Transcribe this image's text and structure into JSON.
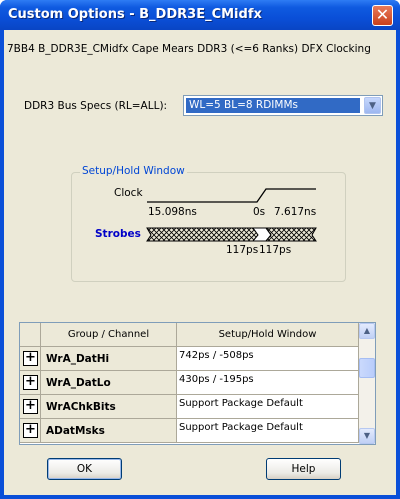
{
  "window": {
    "title": "Custom Options - B_DDR3E_CMidfx",
    "close_glyph": "✕"
  },
  "description": "7BB4 B_DDR3E_CMidfx Cape Mears DDR3 (<=6 Ranks) DFX Clocking",
  "bus_specs": {
    "label": "DDR3 Bus Specs (RL=ALL):",
    "selected": "WL=5  BL=8  RDIMMs",
    "dropdown_icon": "chevron-down-icon"
  },
  "setup_hold": {
    "legend": "Setup/Hold Window",
    "clock_label": "Clock",
    "strobes_label": "Strobes",
    "clock_left": "15.098ns",
    "clock_mid": "0s",
    "clock_right": "7.617ns",
    "strobe_left": "117ps",
    "strobe_right": "117ps"
  },
  "table": {
    "headers": [
      "Group / Channel",
      "Setup/Hold Window"
    ],
    "rows": [
      {
        "expand": "+",
        "channel": "WrA_DatHi",
        "window": "742ps / -508ps"
      },
      {
        "expand": "+",
        "channel": "WrA_DatLo",
        "window": "430ps / -195ps"
      },
      {
        "expand": "+",
        "channel": "WrAChkBits",
        "window": "Support Package Default"
      },
      {
        "expand": "+",
        "channel": "ADatMsks",
        "window": "Support Package Default"
      }
    ]
  },
  "buttons": {
    "ok": "OK",
    "help": "Help"
  },
  "colors": {
    "title_bar": "#0a4fd8",
    "selection": "#316ac5",
    "strobes_text": "#0000c8",
    "group_legend": "#0046d5",
    "dialog_bg": "#ece9d8"
  }
}
